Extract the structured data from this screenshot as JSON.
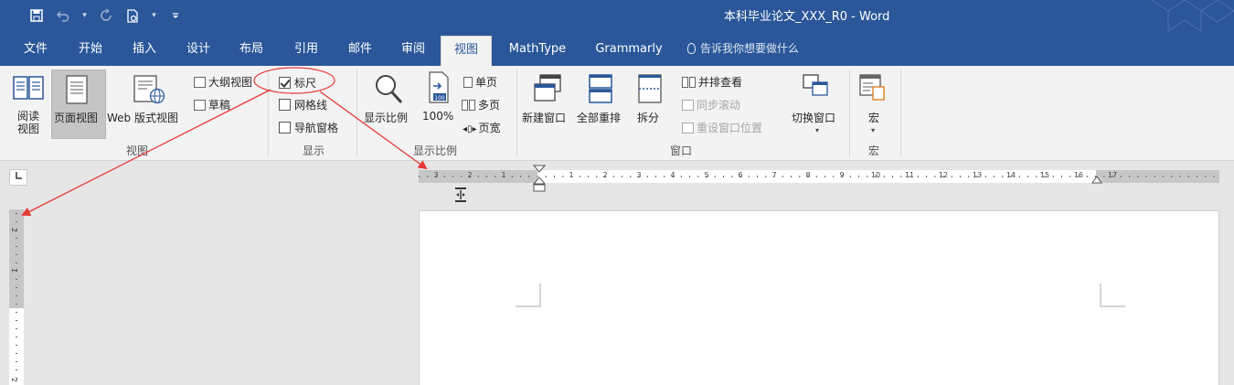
{
  "app": {
    "title": "本科毕业论文_XXX_R0  -  Word"
  },
  "qat": {
    "icons": [
      "save-icon",
      "undo-icon",
      "redo-icon",
      "document-icon",
      "customize-icon"
    ]
  },
  "tabs": [
    {
      "label": "文件",
      "active": false
    },
    {
      "label": "开始",
      "active": false
    },
    {
      "label": "插入",
      "active": false
    },
    {
      "label": "设计",
      "active": false
    },
    {
      "label": "布局",
      "active": false
    },
    {
      "label": "引用",
      "active": false
    },
    {
      "label": "邮件",
      "active": false
    },
    {
      "label": "审阅",
      "active": false
    },
    {
      "label": "视图",
      "active": true
    },
    {
      "label": "MathType",
      "active": false
    },
    {
      "label": "Grammarly",
      "active": false
    }
  ],
  "tellme": "告诉我你想要做什么",
  "ribbon": {
    "views": {
      "group_label": "视图",
      "read_mode": "阅读\n视图",
      "print_layout": "页面视图",
      "web_layout": "Web 版式视图",
      "outline": "大纲视图",
      "draft": "草稿"
    },
    "show": {
      "group_label": "显示",
      "ruler": {
        "label": "标尺",
        "checked": true
      },
      "gridlines": {
        "label": "网格线",
        "checked": false
      },
      "nav_pane": {
        "label": "导航窗格",
        "checked": false
      }
    },
    "zoom": {
      "group_label": "显示比例",
      "zoom": "显示比例",
      "hundred": "100%",
      "one_page": "单页",
      "multi_page": "多页",
      "page_width": "页宽"
    },
    "window": {
      "group_label": "窗口",
      "new_window": "新建窗口",
      "arrange_all": "全部重排",
      "split": "拆分",
      "side_by_side": "并排查看",
      "sync_scroll": "同步滚动",
      "reset_position": "重设窗口位置",
      "switch_windows": "切换窗口"
    },
    "macros": {
      "group_label": "宏",
      "macros": "宏"
    }
  },
  "ruler": {
    "h_labels": [
      "3",
      "2",
      "1",
      "1",
      "2",
      "3",
      "4",
      "5",
      "6",
      "7",
      "8",
      "9",
      "10",
      "11",
      "12",
      "13",
      "14",
      "15",
      "16",
      "17"
    ],
    "v_labels": [
      "2",
      "1",
      "2"
    ]
  },
  "annotations": {
    "color": "#e53935"
  }
}
